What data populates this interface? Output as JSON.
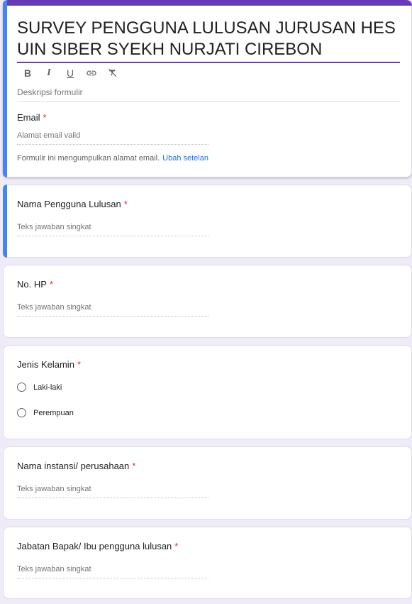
{
  "header": {
    "title": "SURVEY PENGGUNA LULUSAN JURUSAN HES UIN SIBER SYEKH NURJATI CIREBON",
    "description_placeholder": "Deskripsi formulir",
    "toolbar": [
      "bold-icon",
      "italic-icon",
      "underline-icon",
      "link-icon",
      "clear-format-icon"
    ],
    "email_label": "Email",
    "email_placeholder": "Alamat email valid",
    "collect_note": "Formulir ini mengumpulkan alamat email.",
    "collect_link": "Ubah setelan"
  },
  "required_marker": "*",
  "colors": {
    "theme": "#673ab7",
    "active_bar": "#4285f4",
    "required": "#d93025",
    "link": "#1a73e8",
    "background": "#f0ebf8"
  },
  "questions": [
    {
      "label": "Nama Pengguna Lulusan",
      "placeholder": "Teks jawaban singkat"
    },
    {
      "label": "No. HP",
      "placeholder": "Teks jawaban singkat"
    },
    {
      "label": "Jenis Kelamin",
      "options": [
        "Laki-laki",
        "Perempuan"
      ]
    },
    {
      "label": "Nama instansi/ perusahaan",
      "placeholder": "Teks jawaban singkat"
    },
    {
      "label": "Jabatan Bapak/ Ibu pengguna lulusan",
      "placeholder": "Teks jawaban singkat"
    }
  ]
}
